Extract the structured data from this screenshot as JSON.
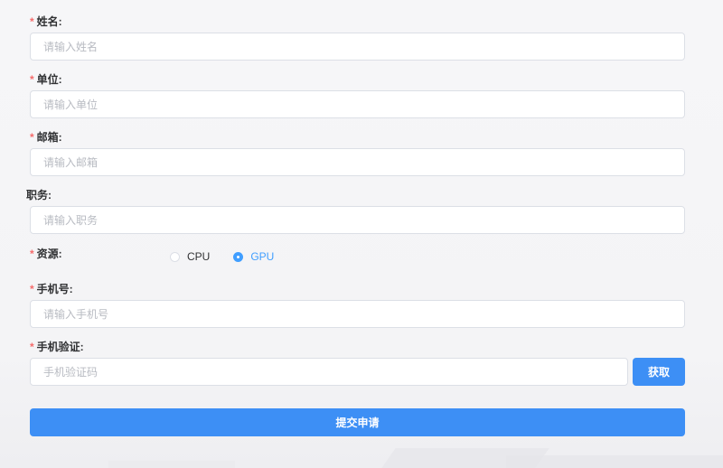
{
  "form": {
    "name": {
      "label": "姓名:",
      "required": "*",
      "placeholder": "请输入姓名",
      "value": ""
    },
    "unit": {
      "label": "单位:",
      "required": "*",
      "placeholder": "请输入单位",
      "value": ""
    },
    "email": {
      "label": "邮箱:",
      "required": "*",
      "placeholder": "请输入邮箱",
      "value": ""
    },
    "position": {
      "label": "职务:",
      "placeholder": "请输入职务",
      "value": ""
    },
    "resource": {
      "label": "资源:",
      "required": "*",
      "options": [
        {
          "label": "CPU",
          "checked": false
        },
        {
          "label": "GPU",
          "checked": true
        }
      ]
    },
    "phone": {
      "label": "手机号:",
      "required": "*",
      "placeholder": "请输入手机号",
      "value": ""
    },
    "verify": {
      "label": "手机验证:",
      "required": "*",
      "placeholder": "手机验证码",
      "value": "",
      "get_code_label": "获取"
    },
    "submit_label": "提交申请"
  },
  "colors": {
    "primary": "#3d8ff5",
    "required_star": "#f56c6c",
    "border": "#dcdfe6",
    "placeholder": "#b8bbc2"
  }
}
